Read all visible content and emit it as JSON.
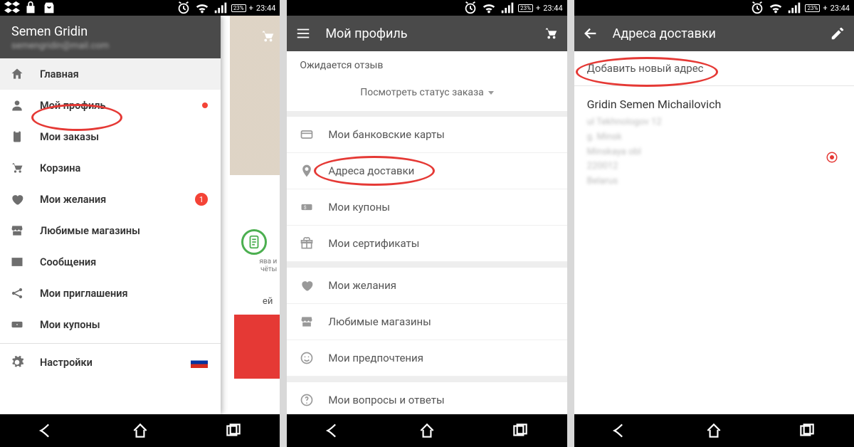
{
  "status": {
    "time": "23:44",
    "battery": "23%"
  },
  "screen1": {
    "header": {
      "name": "Semen Gridin",
      "email": "semengridin@mail.com"
    },
    "drawer": {
      "items": [
        {
          "icon": "home",
          "label": "Главная",
          "active": true
        },
        {
          "icon": "person",
          "label": "Мой профиль",
          "dot": true
        },
        {
          "icon": "clipboard",
          "label": "Мои заказы"
        },
        {
          "icon": "cart",
          "label": "Корзина"
        },
        {
          "icon": "heart",
          "label": "Мои желания",
          "badge": "1"
        },
        {
          "icon": "store",
          "label": "Любимые магазины"
        },
        {
          "icon": "mail",
          "label": "Сообщения"
        },
        {
          "icon": "share",
          "label": "Мои приглашения"
        },
        {
          "icon": "coupon",
          "label": "Мои купоны"
        }
      ],
      "settings_label": "Настройки"
    },
    "bg_text1": "ява и",
    "bg_text2": "чёты",
    "bg_text3": "ей"
  },
  "screen2": {
    "header_title": "Мой профиль",
    "review_label": "Ожидается отзыв",
    "status_link": "Посмотреть статус заказа",
    "groups": [
      [
        {
          "icon": "card",
          "label": "Мои банковские карты"
        },
        {
          "icon": "pin",
          "label": "Адреса доставки"
        },
        {
          "icon": "coupon",
          "label": "Мои купоны"
        },
        {
          "icon": "gift",
          "label": "Мои сертификаты"
        }
      ],
      [
        {
          "icon": "heart",
          "label": "Мои желания"
        },
        {
          "icon": "store",
          "label": "Любимые магазины"
        },
        {
          "icon": "smile",
          "label": "Мои предпочтения"
        }
      ],
      [
        {
          "icon": "help",
          "label": "Мои вопросы и ответы"
        }
      ]
    ]
  },
  "screen3": {
    "header_title": "Адреса доставки",
    "add_label": "Добавить новый адрес",
    "addr_name": "Gridin Semen Michailovich",
    "lines": [
      "ul Tekhnologov 12",
      "g. Minsk",
      "Minskaya obl",
      "220012",
      "Belarus"
    ]
  }
}
